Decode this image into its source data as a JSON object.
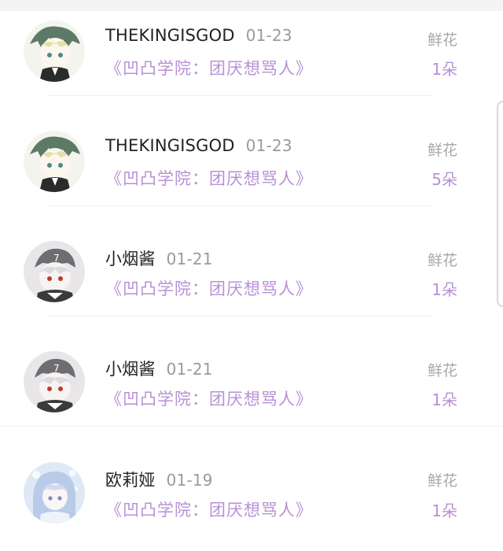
{
  "gift_list": {
    "items": [
      {
        "user": "THEKINGISGOD",
        "date": "01-23",
        "work": "《凹凸学院：团厌想骂人》",
        "gift_type": "鲜花",
        "gift_count": "1朵",
        "avatar": "green-hair-boy-avatar"
      },
      {
        "user": "THEKINGISGOD",
        "date": "01-23",
        "work": "《凹凸学院：团厌想骂人》",
        "gift_type": "鲜花",
        "gift_count": "5朵",
        "avatar": "green-hair-boy-avatar"
      },
      {
        "user": "小烟酱",
        "date": "01-21",
        "work": "《凹凸学院：团厌想骂人》",
        "gift_type": "鲜花",
        "gift_count": "1朵",
        "avatar": "white-hair-cap-avatar"
      },
      {
        "user": "小烟酱",
        "date": "01-21",
        "work": "《凹凸学院：团厌想骂人》",
        "gift_type": "鲜花",
        "gift_count": "1朵",
        "avatar": "white-hair-cap-avatar"
      },
      {
        "user": "欧莉娅",
        "date": "01-19",
        "work": "《凹凸学院：团厌想骂人》",
        "gift_type": "鲜花",
        "gift_count": "1朵",
        "avatar": "blue-hair-girl-avatar"
      }
    ]
  },
  "colors": {
    "accent_purple": "#b890d6",
    "name_text": "#222222",
    "muted_text": "#9a9a9a"
  }
}
